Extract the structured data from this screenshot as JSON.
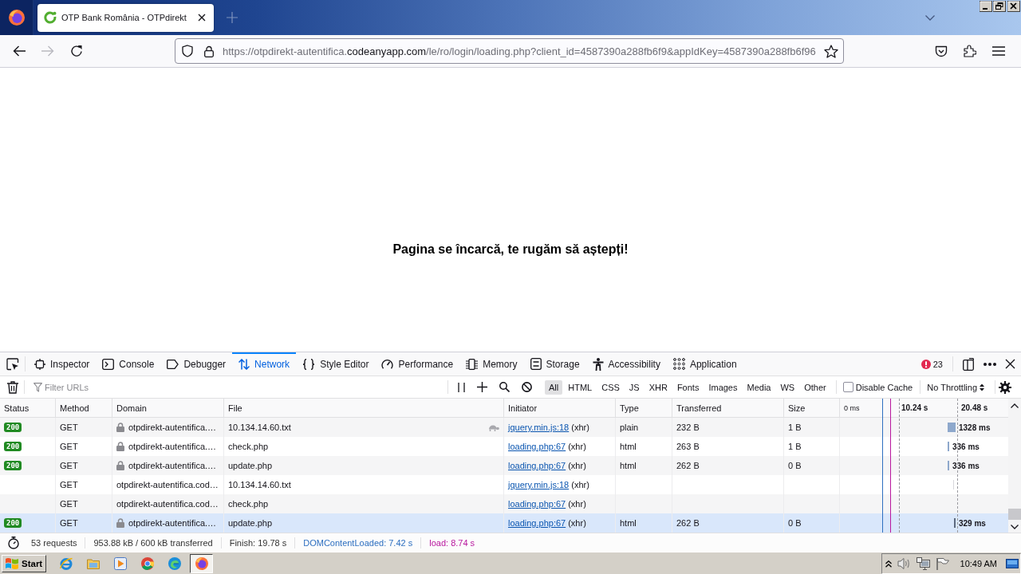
{
  "browser": {
    "tabs": [
      {
        "title": "OTP Bank România - OTPdirekt",
        "selected": true
      }
    ],
    "forward_disabled": true,
    "url": [
      {
        "text": "https://otpdirekt-autentifica.",
        "host": false
      },
      {
        "text": "codeanyapp.com",
        "host": true
      },
      {
        "text": "/le/ro/login/loading.php?client_id=4587390a288fb6f9&appIdKey=4587390a288fb6f96",
        "host": false
      }
    ]
  },
  "page": {
    "message": "Pagina se încarcă, te rugăm să aștepți!"
  },
  "devtools": {
    "tabs": [
      {
        "label": "Inspector",
        "selected": false
      },
      {
        "label": "Console",
        "selected": false
      },
      {
        "label": "Debugger",
        "selected": false
      },
      {
        "label": "Network",
        "selected": true
      },
      {
        "label": "Style Editor",
        "selected": false
      },
      {
        "label": "Performance",
        "selected": false
      },
      {
        "label": "Memory",
        "selected": false
      },
      {
        "label": "Storage",
        "selected": false
      },
      {
        "label": "Accessibility",
        "selected": false
      },
      {
        "label": "Application",
        "selected": false
      }
    ],
    "error_count": "23",
    "filter": {
      "placeholder": "Filter URLs"
    },
    "type_filters": [
      {
        "label": "All",
        "selected": true
      },
      {
        "label": "HTML",
        "selected": false
      },
      {
        "label": "CSS",
        "selected": false
      },
      {
        "label": "JS",
        "selected": false
      },
      {
        "label": "XHR",
        "selected": false
      },
      {
        "label": "Fonts",
        "selected": false
      },
      {
        "label": "Images",
        "selected": false
      },
      {
        "label": "Media",
        "selected": false
      },
      {
        "label": "WS",
        "selected": false
      },
      {
        "label": "Other",
        "selected": false
      }
    ],
    "disable_cache": {
      "label": "Disable Cache",
      "checked": false
    },
    "throttling": "No Throttling",
    "table": {
      "columns": [
        "Status",
        "Method",
        "Domain",
        "File",
        "Initiator",
        "Type",
        "Transferred",
        "Size"
      ],
      "timeline_ticks": [
        "0 ms",
        "10.24 s",
        "20.48 s"
      ],
      "rows": [
        {
          "status": "200",
          "method": "GET",
          "secure": true,
          "domain": "otpdirekt-autentifica.…",
          "file": "10.134.14.60.txt",
          "slow": true,
          "initiator": "jquery.min.js:18",
          "cause": "(xhr)",
          "type": "plain",
          "transferred": "232 B",
          "size": "1 B",
          "bar": {
            "kind": "block"
          },
          "timing": "1328 ms",
          "selected": false
        },
        {
          "status": "200",
          "method": "GET",
          "secure": true,
          "domain": "otpdirekt-autentifica.…",
          "file": "check.php",
          "slow": false,
          "initiator": "loading.php:67",
          "cause": "(xhr)",
          "type": "html",
          "transferred": "263 B",
          "size": "1 B",
          "bar": {
            "kind": "line"
          },
          "timing": "336 ms",
          "selected": false
        },
        {
          "status": "200",
          "method": "GET",
          "secure": true,
          "domain": "otpdirekt-autentifica.…",
          "file": "update.php",
          "slow": false,
          "initiator": "loading.php:67",
          "cause": "(xhr)",
          "type": "html",
          "transferred": "262 B",
          "size": "0 B",
          "bar": {
            "kind": "line"
          },
          "timing": "336 ms",
          "selected": false
        },
        {
          "method": "GET",
          "secure": false,
          "domain": "otpdirekt-autentifica.cod…",
          "file": "10.134.14.60.txt",
          "slow": false,
          "initiator": "jquery.min.js:18",
          "cause": "(xhr)",
          "bar": {
            "kind": "faint"
          },
          "selected": false
        },
        {
          "method": "GET",
          "secure": false,
          "domain": "otpdirekt-autentifica.cod…",
          "file": "check.php",
          "slow": false,
          "initiator": "loading.php:67",
          "cause": "(xhr)",
          "selected": false
        },
        {
          "status": "200",
          "method": "GET",
          "secure": true,
          "domain": "otpdirekt-autentifica.…",
          "file": "update.php",
          "slow": false,
          "initiator": "loading.php:67",
          "cause": "(xhr)",
          "type": "html",
          "transferred": "262 B",
          "size": "0 B",
          "bar": {
            "kind": "dark"
          },
          "timing": "329 ms",
          "selected": true
        }
      ]
    },
    "summary": [
      {
        "text": "53 requests",
        "color": "#333333"
      },
      {
        "text": "953.88 kB / 600 kB transferred",
        "color": "#333333"
      },
      {
        "text": "Finish: 19.78 s",
        "color": "#333333"
      },
      {
        "text": "DOMContentLoaded: 7.42 s",
        "color": "#2d6fc0"
      },
      {
        "text": "load: 8.74 s",
        "color": "#b8179e"
      }
    ]
  },
  "taskbar": {
    "start": "Start",
    "apps": [
      {
        "selected": false
      },
      {
        "selected": false
      },
      {
        "selected": false
      },
      {
        "selected": false
      },
      {
        "selected": false
      },
      {
        "selected": true
      }
    ],
    "clock": "10:49 AM"
  }
}
